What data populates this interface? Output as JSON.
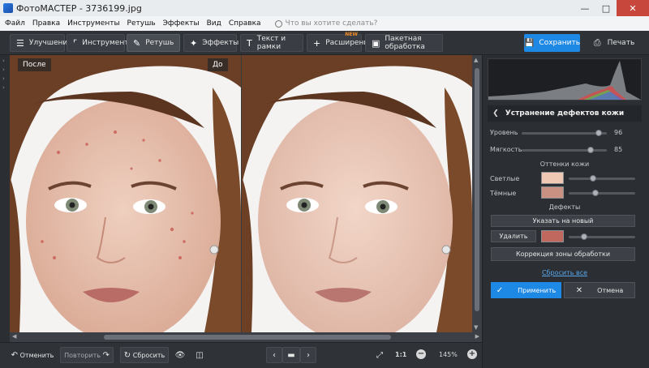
{
  "window": {
    "title": "ФотоМАСТЕР - 3736199.jpg"
  },
  "menu": {
    "items": [
      "Файл",
      "Правка",
      "Инструменты",
      "Ретушь",
      "Эффекты",
      "Вид",
      "Справка"
    ],
    "search_placeholder": "Что вы хотите сделать?"
  },
  "toolbar": {
    "tabs": [
      {
        "label": "Улучшения",
        "icon": "sliders-icon"
      },
      {
        "label": "Инструменты",
        "icon": "crop-icon"
      },
      {
        "label": "Ретушь",
        "icon": "brush-icon"
      },
      {
        "label": "Эффекты",
        "icon": "sparkle-icon"
      },
      {
        "label": "Текст и рамки",
        "icon": "text-icon"
      },
      {
        "label": "Расширения",
        "icon": "plus-icon",
        "badge": "NEW"
      },
      {
        "label": "Пакетная обработка",
        "icon": "batch-icon"
      }
    ],
    "active_tab": "Ретушь",
    "save_label": "Сохранить",
    "print_label": "Печать"
  },
  "canvas": {
    "before_label": "До",
    "after_label": "После"
  },
  "panel": {
    "title": "Устранение дефектов кожи",
    "sliders": [
      {
        "label": "Уровень",
        "value": 96
      },
      {
        "label": "Мягкость",
        "value": 85
      }
    ],
    "skin_tones_heading": "Оттенки кожи",
    "tones": [
      {
        "label": "Светлые",
        "color": "#f0c9b4"
      },
      {
        "label": "Тёмные",
        "color": "#c99182"
      }
    ],
    "defects_heading": "Дефекты",
    "point_button": "Указать на новый",
    "remove_label": "Удалить",
    "defect_color": "#c0685e",
    "zone_button": "Коррекция зоны обработки",
    "reset_all": "Сбросить все",
    "apply_label": "Применить",
    "cancel_label": "Отмена"
  },
  "bottom": {
    "undo_label": "Отменить",
    "redo_label": "Повторить",
    "reset_label": "Сбросить",
    "zoom_ratio": "1:1",
    "zoom_percent": "145%"
  },
  "colors": {
    "accent": "#1e88e5",
    "background": "#2b2e33",
    "new_badge": "#f08a24"
  }
}
